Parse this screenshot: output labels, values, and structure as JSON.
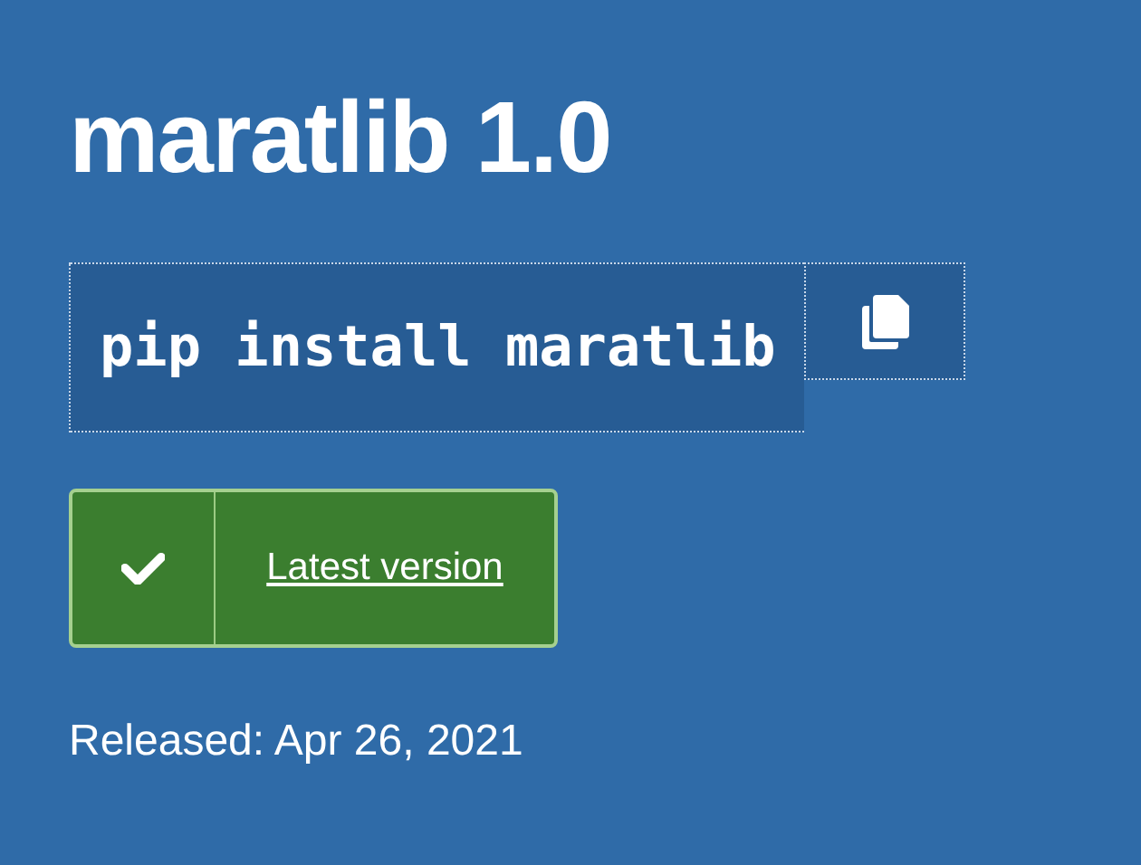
{
  "package": {
    "title": "maratlib 1.0"
  },
  "install": {
    "command": "pip install maratlib"
  },
  "version_badge": {
    "label": "Latest version"
  },
  "release": {
    "text": "Released: Apr 26, 2021"
  }
}
